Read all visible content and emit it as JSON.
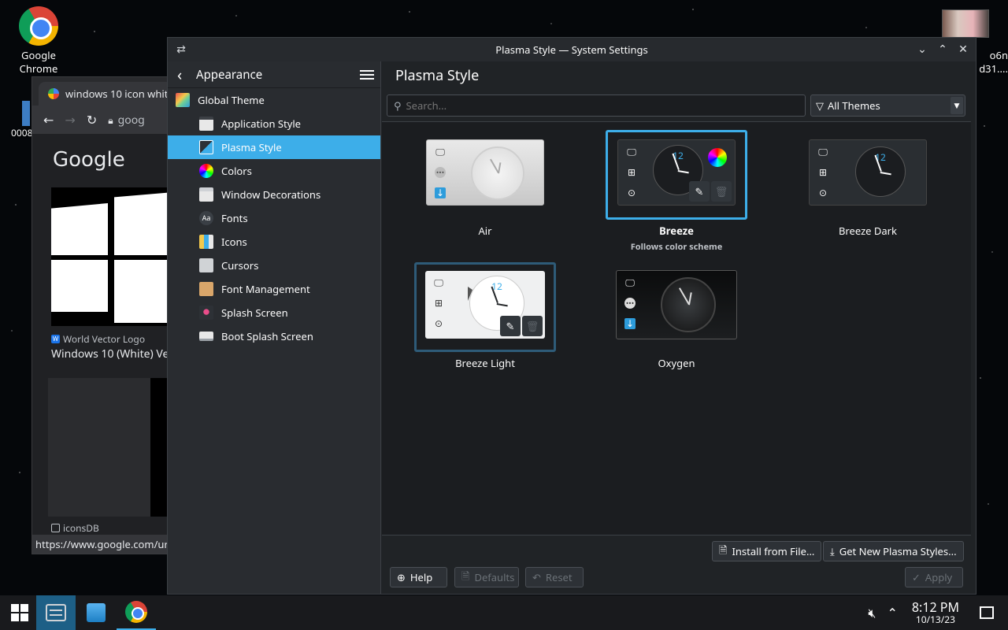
{
  "desktop": {
    "chrome_icon_label_line1": "Google",
    "chrome_icon_label_line2": "Chrome",
    "partial_left_label": "0008",
    "partial_right_label_line1": "o6n",
    "partial_right_label_line2": "d31...."
  },
  "browser": {
    "tab_title": "windows 10 icon whit",
    "url_partial": "goog",
    "google_logo": "Google",
    "result1_source": "World Vector Logo",
    "result1_title": "Windows 10 (White) Ve",
    "result2_source": "iconsDB",
    "status_url": "https://www.google.com/ur"
  },
  "window": {
    "title": "Plasma Style — System Settings"
  },
  "sidebar": {
    "header": "Appearance",
    "items": [
      {
        "label": "Global Theme",
        "level": 0
      },
      {
        "label": "Application Style",
        "level": 1
      },
      {
        "label": "Plasma Style",
        "level": 1,
        "selected": true
      },
      {
        "label": "Colors",
        "level": 1
      },
      {
        "label": "Window Decorations",
        "level": 1
      },
      {
        "label": "Fonts",
        "level": 1
      },
      {
        "label": "Icons",
        "level": 1
      },
      {
        "label": "Cursors",
        "level": 1
      },
      {
        "label": "Font Management",
        "level": 1
      },
      {
        "label": "Splash Screen",
        "level": 1
      },
      {
        "label": "Boot Splash Screen",
        "level": 1
      }
    ]
  },
  "content": {
    "title": "Plasma Style",
    "search_placeholder": "Search...",
    "filter_label": "All Themes",
    "themes": [
      {
        "name": "Air",
        "subtitle": ""
      },
      {
        "name": "Breeze",
        "subtitle": "Follows color scheme",
        "current": true
      },
      {
        "name": "Breeze Dark",
        "subtitle": ""
      },
      {
        "name": "Breeze Light",
        "subtitle": ""
      },
      {
        "name": "Oxygen",
        "subtitle": ""
      }
    ],
    "clock_number": "12",
    "buttons": {
      "install": "Install from File...",
      "get_new": "Get New Plasma Styles...",
      "help": "Help",
      "defaults": "Defaults",
      "reset": "Reset",
      "apply": "Apply"
    }
  },
  "taskbar": {
    "time": "8:12 PM",
    "date": "10/13/23"
  },
  "colors": {
    "accent": "#3daee9",
    "window_bg": "#202326",
    "sidebar_bg": "#292c30",
    "taskbar_active": "#1d5f86"
  }
}
